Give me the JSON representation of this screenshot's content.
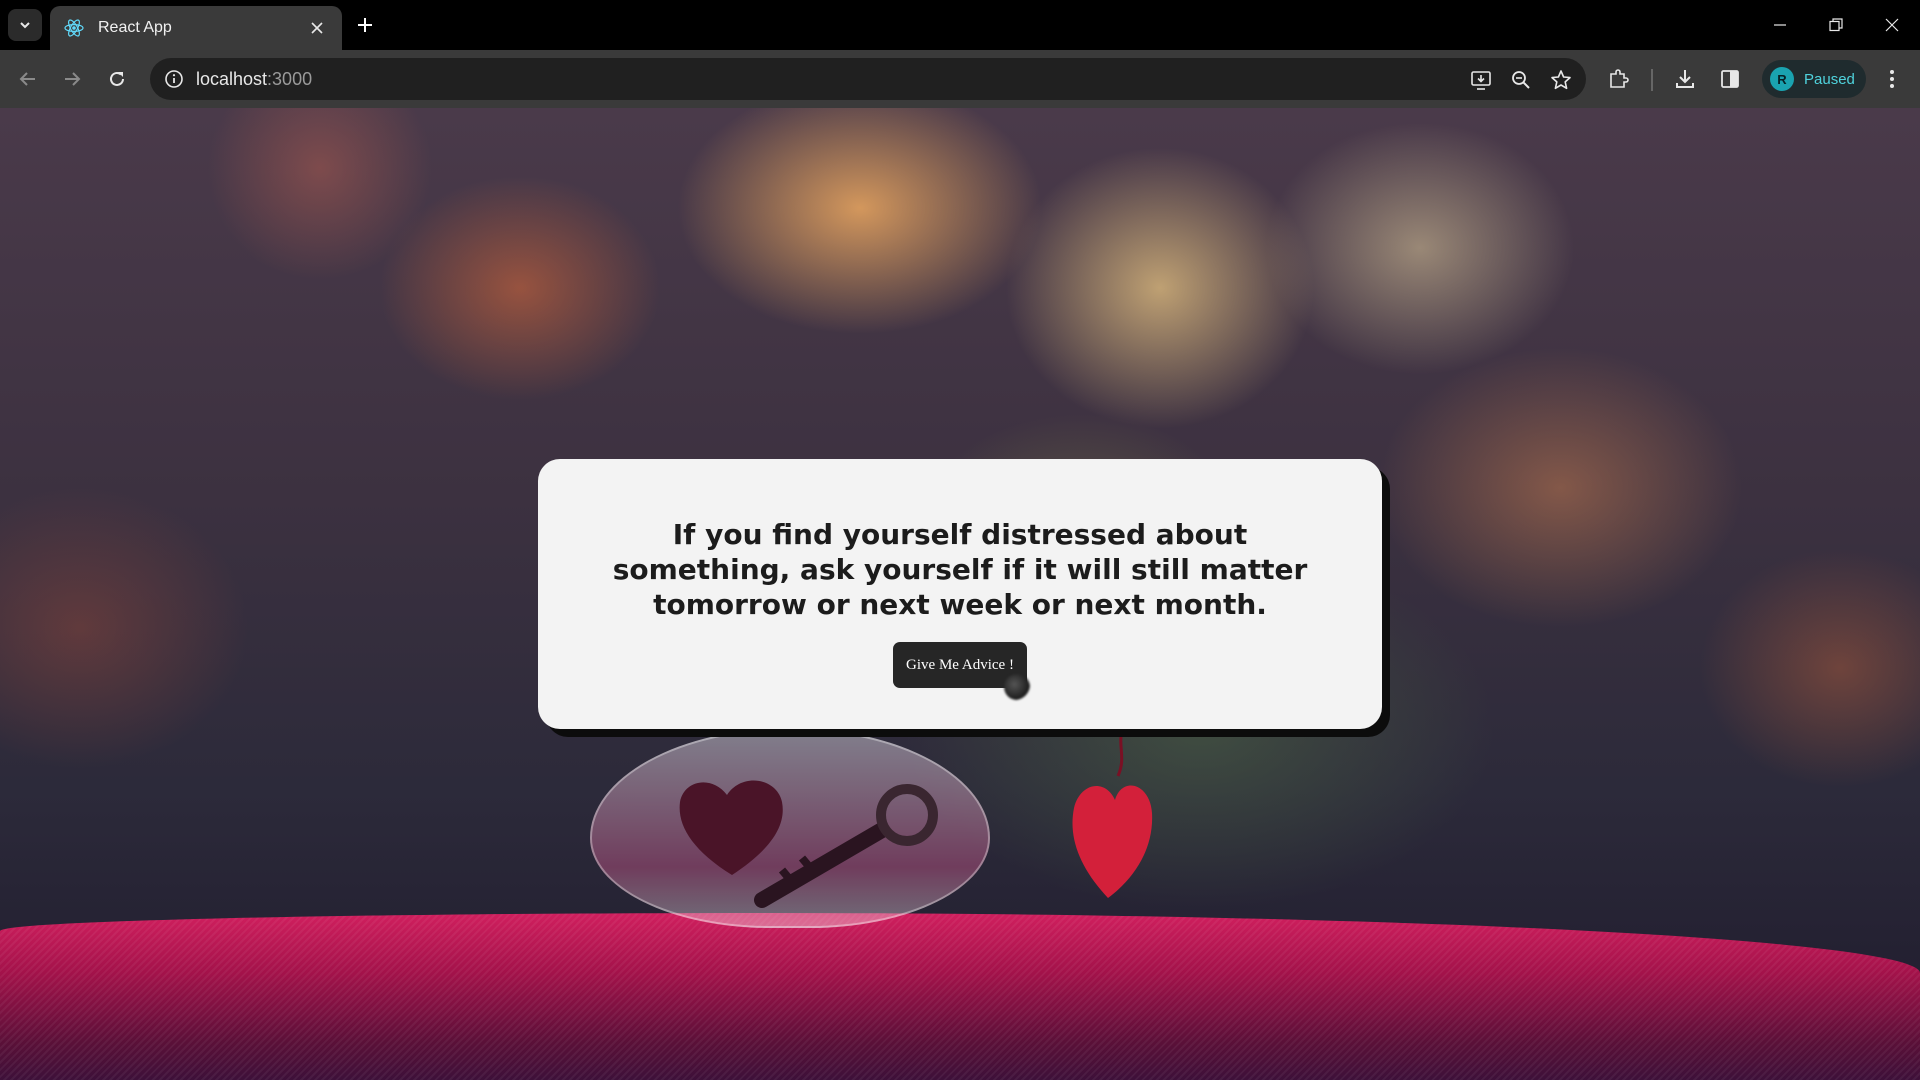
{
  "browser": {
    "tab_title": "React App",
    "url_host": "localhost",
    "url_port": ":3000",
    "profile_initial": "R",
    "profile_status": "Paused"
  },
  "card": {
    "advice": "If you find yourself distressed about something, ask yourself if it will still matter tomorrow or next week or next month.",
    "button_label": "Give Me Advice !"
  },
  "colors": {
    "card_bg": "#f3f3f3",
    "button_bg": "#262626",
    "profile_accent": "#4fd2dc",
    "fabric": "#c0164f"
  },
  "icons": {
    "tab_search": "chevron-down-icon",
    "favicon": "react-icon",
    "close": "close-icon",
    "new_tab": "plus-icon",
    "back": "arrow-left-icon",
    "forward": "arrow-right-icon",
    "reload": "reload-icon",
    "site_info": "info-icon",
    "install": "install-app-icon",
    "zoom": "zoom-out-icon",
    "bookmark": "star-icon",
    "extensions": "puzzle-icon",
    "downloads": "download-icon",
    "side_panel": "side-panel-icon",
    "menu": "kebab-menu-icon"
  }
}
